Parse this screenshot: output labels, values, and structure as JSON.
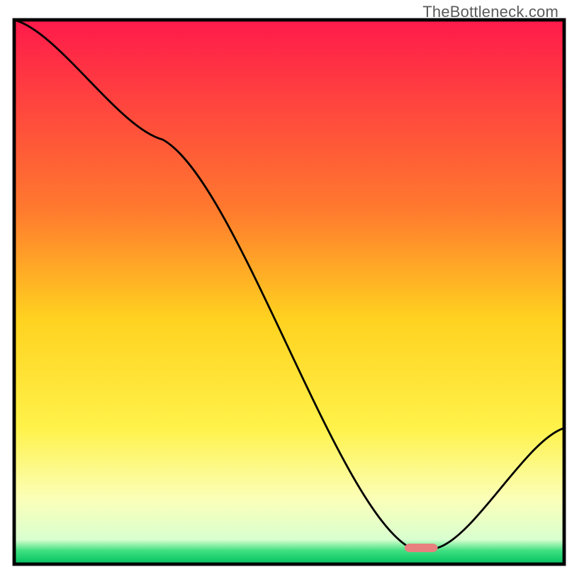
{
  "watermark": "TheBottleneck.com",
  "chart_data": {
    "type": "line",
    "title": "",
    "xlabel": "",
    "ylabel": "",
    "xlim": [
      0,
      100
    ],
    "ylim": [
      0,
      100
    ],
    "x": [
      0,
      27,
      72,
      77,
      100
    ],
    "values": [
      100,
      78,
      3,
      3,
      25
    ],
    "marker": {
      "x_range": [
        71,
        77
      ],
      "y": 3
    },
    "gradient_stops": [
      {
        "offset": 0.0,
        "color": "#ff1a4b"
      },
      {
        "offset": 0.35,
        "color": "#ff7a2e"
      },
      {
        "offset": 0.55,
        "color": "#ffd21f"
      },
      {
        "offset": 0.75,
        "color": "#fff24a"
      },
      {
        "offset": 0.88,
        "color": "#fbffb8"
      },
      {
        "offset": 0.955,
        "color": "#d9ffd0"
      },
      {
        "offset": 0.975,
        "color": "#40e080"
      },
      {
        "offset": 1.0,
        "color": "#00c060"
      }
    ],
    "frame": {
      "x": 2.5,
      "y": 3.5,
      "w": 97,
      "h": 96
    },
    "marker_style": {
      "fill": "#e98080",
      "rx": 0.9,
      "h": 1.5
    }
  }
}
